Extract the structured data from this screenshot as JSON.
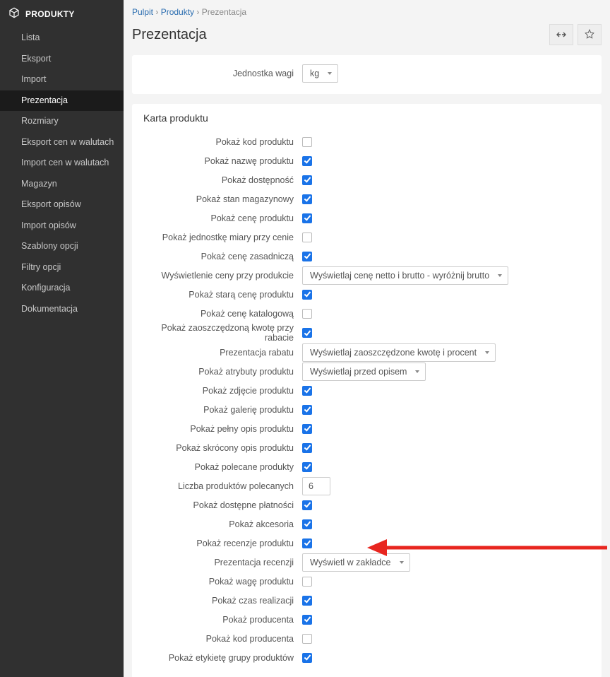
{
  "sidebar": {
    "title": "PRODUKTY",
    "items": [
      {
        "label": "Lista",
        "active": false
      },
      {
        "label": "Eksport",
        "active": false
      },
      {
        "label": "Import",
        "active": false
      },
      {
        "label": "Prezentacja",
        "active": true
      },
      {
        "label": "Rozmiary",
        "active": false
      },
      {
        "label": "Eksport cen w walutach",
        "active": false
      },
      {
        "label": "Import cen w walutach",
        "active": false
      },
      {
        "label": "Magazyn",
        "active": false
      },
      {
        "label": "Eksport opisów",
        "active": false
      },
      {
        "label": "Import opisów",
        "active": false
      },
      {
        "label": "Szablony opcji",
        "active": false
      },
      {
        "label": "Filtry opcji",
        "active": false
      },
      {
        "label": "Konfiguracja",
        "active": false
      },
      {
        "label": "Dokumentacja",
        "active": false
      }
    ]
  },
  "breadcrumb": {
    "p0": "Pulpit",
    "sep": " › ",
    "p1": "Produkty",
    "p2": "Prezentacja"
  },
  "page": {
    "title": "Prezentacja"
  },
  "panel1": {
    "weight_unit_label": "Jednostka wagi",
    "weight_unit_value": "kg"
  },
  "panel2": {
    "title": "Karta produktu",
    "rows": [
      {
        "label": "Pokaż kod produktu",
        "type": "checkbox",
        "checked": false
      },
      {
        "label": "Pokaż nazwę produktu",
        "type": "checkbox",
        "checked": true
      },
      {
        "label": "Pokaż dostępność",
        "type": "checkbox",
        "checked": true
      },
      {
        "label": "Pokaż stan magazynowy",
        "type": "checkbox",
        "checked": true
      },
      {
        "label": "Pokaż cenę produktu",
        "type": "checkbox",
        "checked": true
      },
      {
        "label": "Pokaż jednostkę miary przy cenie",
        "type": "checkbox",
        "checked": false
      },
      {
        "label": "Pokaż cenę zasadniczą",
        "type": "checkbox",
        "checked": true
      },
      {
        "label": "Wyświetlenie ceny przy produkcie",
        "type": "select",
        "value": "Wyświetlaj cenę netto i brutto - wyróżnij brutto"
      },
      {
        "label": "Pokaż starą cenę produktu",
        "type": "checkbox",
        "checked": true
      },
      {
        "label": "Pokaż cenę katalogową",
        "type": "checkbox",
        "checked": false
      },
      {
        "label": "Pokaż zaoszczędzoną kwotę przy rabacie",
        "type": "checkbox",
        "checked": true
      },
      {
        "label": "Prezentacja rabatu",
        "type": "select",
        "value": "Wyświetlaj zaoszczędzone kwotę i procent"
      },
      {
        "label": "Pokaż atrybuty produktu",
        "type": "select",
        "value": "Wyświetlaj przed opisem"
      },
      {
        "label": "Pokaż zdjęcie produktu",
        "type": "checkbox",
        "checked": true
      },
      {
        "label": "Pokaż galerię produktu",
        "type": "checkbox",
        "checked": true
      },
      {
        "label": "Pokaż pełny opis produktu",
        "type": "checkbox",
        "checked": true
      },
      {
        "label": "Pokaż skrócony opis produktu",
        "type": "checkbox",
        "checked": true
      },
      {
        "label": "Pokaż polecane produkty",
        "type": "checkbox",
        "checked": true
      },
      {
        "label": "Liczba produktów polecanych",
        "type": "text",
        "value": "6"
      },
      {
        "label": "Pokaż dostępne płatności",
        "type": "checkbox",
        "checked": true
      },
      {
        "label": "Pokaż akcesoria",
        "type": "checkbox",
        "checked": true
      },
      {
        "label": "Pokaż recenzje produktu",
        "type": "checkbox",
        "checked": true
      },
      {
        "label": "Prezentacja recenzji",
        "type": "select",
        "value": "Wyświetl w zakładce",
        "wide": true
      },
      {
        "label": "Pokaż wagę produktu",
        "type": "checkbox",
        "checked": false
      },
      {
        "label": "Pokaż czas realizacji",
        "type": "checkbox",
        "checked": true
      },
      {
        "label": "Pokaż producenta",
        "type": "checkbox",
        "checked": true
      },
      {
        "label": "Pokaż kod producenta",
        "type": "checkbox",
        "checked": false
      },
      {
        "label": "Pokaż etykietę grupy produktów",
        "type": "checkbox",
        "checked": true
      }
    ]
  }
}
